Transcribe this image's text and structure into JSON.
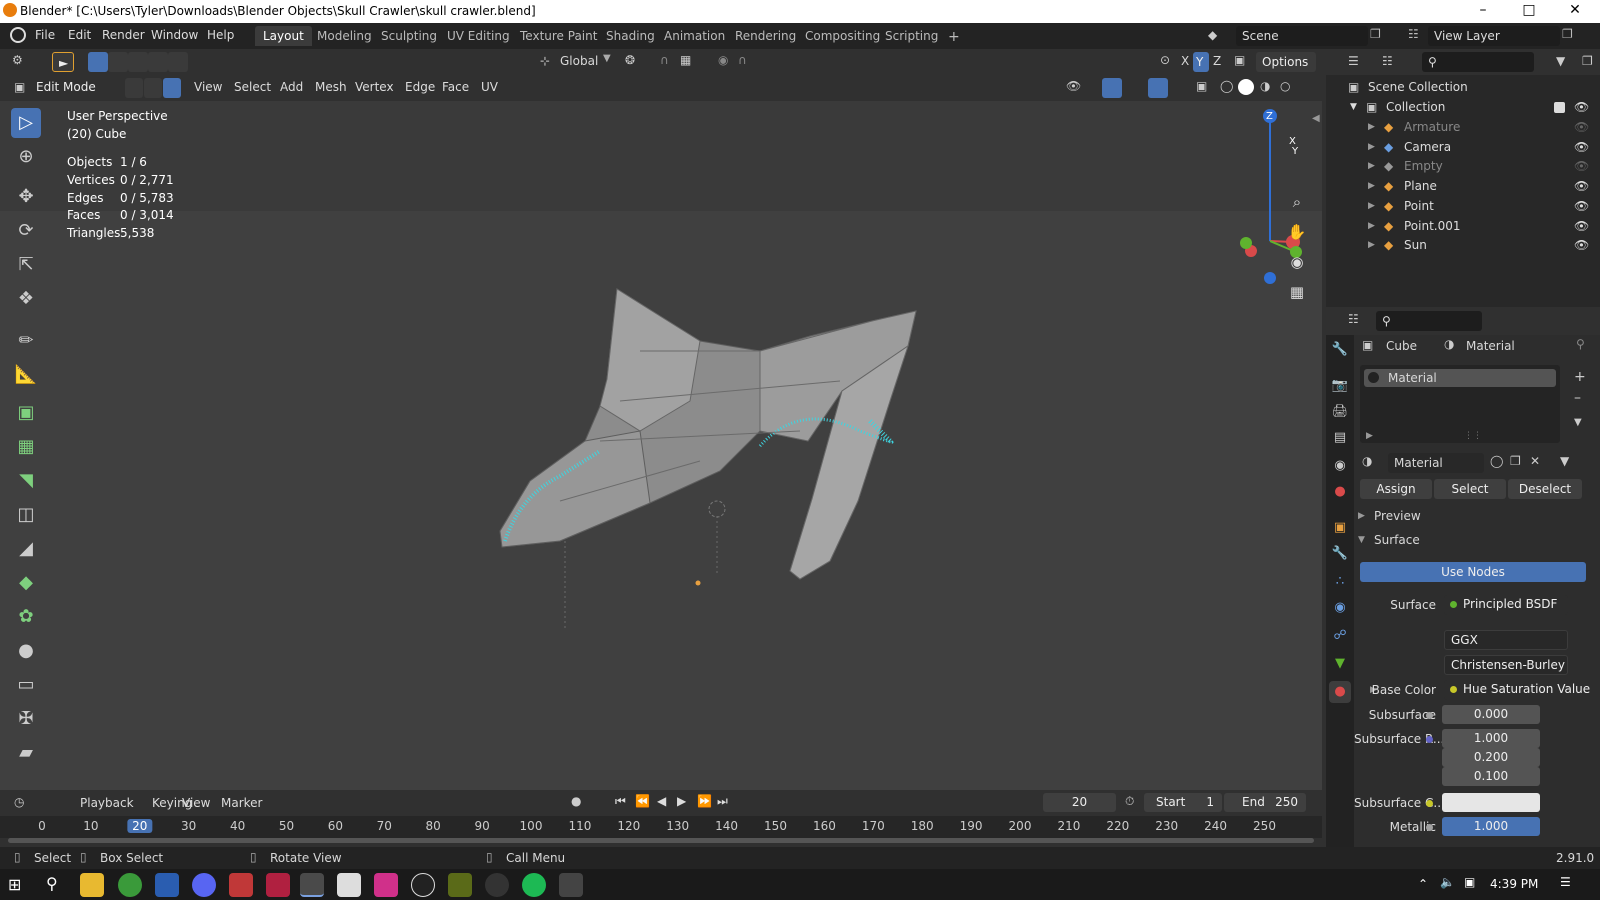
{
  "window": {
    "title": "Blender* [C:\\Users\\Tyler\\Downloads\\Blender Objects\\Skull Crawler\\skull crawler.blend]"
  },
  "menu": [
    "File",
    "Edit",
    "Render",
    "Window",
    "Help"
  ],
  "workspaces": [
    "Layout",
    "Modeling",
    "Sculpting",
    "UV Editing",
    "Texture Paint",
    "Shading",
    "Animation",
    "Rendering",
    "Compositing",
    "Scripting"
  ],
  "scene": {
    "name": "Scene",
    "view_layer": "View Layer"
  },
  "header": {
    "transform_orientation": "Global",
    "options_label": "Options",
    "axes": [
      "X",
      "Y",
      "Z"
    ],
    "mode": "Edit Mode",
    "edit_menus": [
      "View",
      "Select",
      "Add",
      "Mesh",
      "Vertex",
      "Edge",
      "Face",
      "UV"
    ]
  },
  "viewport": {
    "perspective": "User Perspective",
    "object": "(20) Cube",
    "stats": [
      {
        "label": "Objects",
        "value": "1 / 6"
      },
      {
        "label": "Vertices",
        "value": "0 / 2,771"
      },
      {
        "label": "Edges",
        "value": "0 / 5,783"
      },
      {
        "label": "Faces",
        "value": "0 / 3,014"
      },
      {
        "label": "Triangles",
        "value": "5,538"
      }
    ],
    "gizmo": {
      "x": "X",
      "y": "Y",
      "z": "Z"
    }
  },
  "timeline": {
    "menus": [
      "Playback",
      "Keying",
      "View",
      "Marker"
    ],
    "current_frame": "20",
    "start_label": "Start",
    "start": "1",
    "end_label": "End",
    "end": "250",
    "ticks": [
      "0",
      "10",
      "20",
      "30",
      "40",
      "50",
      "60",
      "70",
      "80",
      "90",
      "100",
      "110",
      "120",
      "130",
      "140",
      "150",
      "160",
      "170",
      "180",
      "190",
      "200",
      "210",
      "220",
      "230",
      "240",
      "250"
    ]
  },
  "statusbar": {
    "items": [
      "Select",
      "Box Select",
      "Rotate View",
      "Call Menu"
    ],
    "version": "2.91.0"
  },
  "outliner": {
    "scene_collection": "Scene Collection",
    "collection": "Collection",
    "objects": [
      {
        "name": "Armature",
        "dim": true
      },
      {
        "name": "Camera",
        "dim": false
      },
      {
        "name": "Empty",
        "dim": true
      },
      {
        "name": "Plane",
        "dim": false
      },
      {
        "name": "Point",
        "dim": false
      },
      {
        "name": "Point.001",
        "dim": false
      },
      {
        "name": "Sun",
        "dim": false
      }
    ]
  },
  "properties": {
    "breadcrumb_object": "Cube",
    "breadcrumb_material": "Material",
    "slot": "Material",
    "material_name": "Material",
    "assign": "Assign",
    "select": "Select",
    "deselect": "Deselect",
    "preview": "Preview",
    "surface_panel": "Surface",
    "use_nodes": "Use Nodes",
    "surface_label": "Surface",
    "surface_value": "Principled BSDF",
    "distribution": "GGX",
    "subsurface_method": "Christensen-Burley",
    "base_color_label": "Base Color",
    "base_color_value": "Hue Saturation Value",
    "subsurface_label": "Subsurface",
    "subsurface_value": "0.000",
    "subsurface_radius_label": "Subsurface R...",
    "subsurface_radius": [
      "1.000",
      "0.200",
      "0.100"
    ],
    "subsurface_color_label": "Subsurface C...",
    "metallic_label": "Metallic",
    "metallic_value": "1.000"
  },
  "taskbar": {
    "time": "4:39 PM"
  },
  "colors": {
    "accent": "#4772b3",
    "selected_verts": "#3fd4e0",
    "header": "#303030",
    "viewport": "#3d3d3d"
  }
}
